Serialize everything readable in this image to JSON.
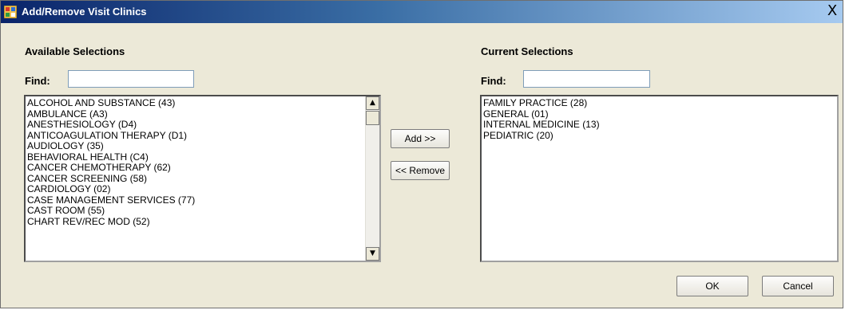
{
  "window": {
    "title": "Add/Remove Visit Clinics",
    "close_glyph": "X",
    "app_icon": "app-icon",
    "close_icon": "close-icon"
  },
  "available": {
    "heading": "Available Selections",
    "find_label": "Find:",
    "find_value": "",
    "items": [
      "ALCOHOL AND SUBSTANCE (43)",
      "AMBULANCE (A3)",
      "ANESTHESIOLOGY (D4)",
      "ANTICOAGULATION THERAPY (D1)",
      "AUDIOLOGY (35)",
      "BEHAVIORAL HEALTH (C4)",
      "CANCER CHEMOTHERAPY (62)",
      "CANCER SCREENING (58)",
      "CARDIOLOGY (02)",
      "CASE MANAGEMENT SERVICES (77)",
      "CAST ROOM (55)",
      "CHART REV/REC MOD (52)"
    ]
  },
  "current": {
    "heading": "Current Selections",
    "find_label": "Find:",
    "find_value": "",
    "items": [
      "FAMILY PRACTICE (28)",
      "GENERAL (01)",
      "INTERNAL MEDICINE (13)",
      "PEDIATRIC (20)"
    ]
  },
  "buttons": {
    "add": "Add >>",
    "remove": "<< Remove",
    "ok": "OK",
    "cancel": "Cancel"
  },
  "scrollbar": {
    "up_glyph": "▲",
    "down_glyph": "▼"
  },
  "colors": {
    "title_bar_start": "#0a246a",
    "title_bar_end": "#a6caf0",
    "dialog_background": "#ece9d8"
  }
}
